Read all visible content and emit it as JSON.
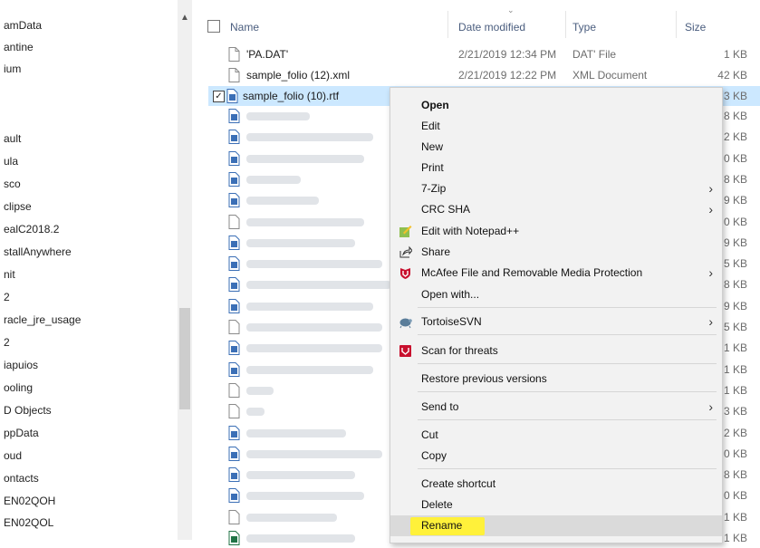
{
  "nav": {
    "items": [
      "amData",
      "antine",
      "ium",
      "ault",
      "ula",
      "sco",
      "clipse",
      "ealC2018.2",
      "stallAnywhere",
      "nit",
      "2",
      "racle_jre_usage",
      "2",
      "iapuios",
      "ooling",
      "D Objects",
      "ppData",
      "oud",
      "ontacts",
      "EN02QOH",
      "EN02QOL"
    ]
  },
  "header": {
    "name": "Name",
    "date": "Date modified",
    "type": "Type",
    "size": "Size"
  },
  "files": [
    {
      "name": "'PA.DAT'",
      "date": "2/21/2019 12:34 PM",
      "type": "DAT' File",
      "size": "1 KB"
    },
    {
      "name": "sample_folio (12).xml",
      "date": "2/21/2019 12:22 PM",
      "type": "XML Document",
      "size": "42 KB"
    },
    {
      "name": "sample_folio (10).rtf",
      "size": "3 KB"
    }
  ],
  "hidden_sizes": [
    "8 KB",
    "2 KB",
    "0 KB",
    "8 KB",
    "9 KB",
    "0 KB",
    "9 KB",
    "5 KB",
    "8 KB",
    "9 KB",
    "5 KB",
    "1 KB",
    "1 KB",
    "1 KB",
    "3 KB",
    "2 KB",
    "0 KB",
    "8 KB",
    "0 KB",
    "1 KB",
    "1 KB"
  ],
  "menu": {
    "open": "Open",
    "edit": "Edit",
    "new": "New",
    "print": "Print",
    "zip": "7-Zip",
    "crc": "CRC SHA",
    "notepad": "Edit with Notepad++",
    "share": "Share",
    "mcafee": "McAfee File and Removable Media Protection",
    "open_with": "Open with...",
    "tortoise": "TortoiseSVN",
    "scan": "Scan for threats",
    "restore": "Restore previous versions",
    "send_to": "Send to",
    "cut": "Cut",
    "copy": "Copy",
    "shortcut": "Create shortcut",
    "delete": "Delete",
    "rename": "Rename"
  },
  "colors": {
    "selection": "#cce8ff",
    "highlight_marker": "#fff13a",
    "mcafee_red": "#c8102e",
    "word_blue": "#2b579a",
    "excel_green": "#217346"
  }
}
